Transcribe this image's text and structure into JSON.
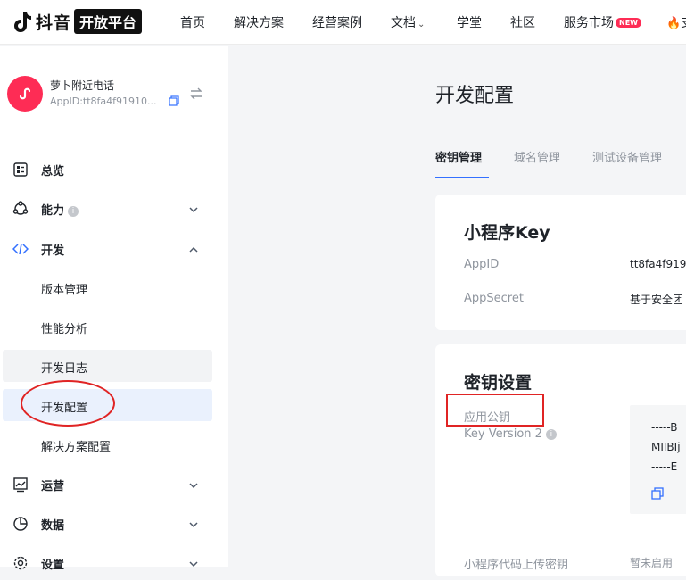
{
  "brand": {
    "name": "抖音",
    "badge": "开放平台"
  },
  "nav": {
    "items": [
      "首页",
      "解决方案",
      "经营案例",
      "文档",
      "学堂",
      "社区",
      "服务市场",
      "支"
    ],
    "new_badge": "NEW",
    "accent_color": "#fe2c55"
  },
  "app": {
    "name": "萝卜附近电话",
    "app_id": "AppID:tt8fa4f91910..."
  },
  "sidebar": {
    "menu": [
      {
        "label": "总览",
        "icon": "overview-icon"
      },
      {
        "label": "能力",
        "icon": "capability-icon"
      },
      {
        "label": "开发",
        "icon": "code-icon"
      },
      {
        "label": "运营",
        "icon": "operation-chart-icon"
      },
      {
        "label": "数据",
        "icon": "pie-chart-icon"
      },
      {
        "label": "设置",
        "icon": "settings-icon"
      }
    ],
    "dev_sub": [
      "版本管理",
      "性能分析",
      "开发日志",
      "开发配置",
      "解决方案配置"
    ],
    "active_color": "#3370ff"
  },
  "main": {
    "title": "开发配置",
    "tabs": [
      "密钥管理",
      "域名管理",
      "测试设备管理"
    ],
    "key_card": {
      "title": "小程序Key",
      "appid_label": "AppID",
      "appid_value": "tt8fa4f919",
      "secret_label": "AppSecret",
      "secret_value": "基于安全团"
    },
    "secret_card": {
      "title": "密钥设置",
      "pubkey_label": "应用公钥",
      "version_label": "Key Version 2",
      "key_lines": [
        "-----B",
        "MIIBIj",
        "-----E"
      ],
      "upload_label": "小程序代码上传密钥",
      "upload_value": "暂未启用"
    }
  }
}
